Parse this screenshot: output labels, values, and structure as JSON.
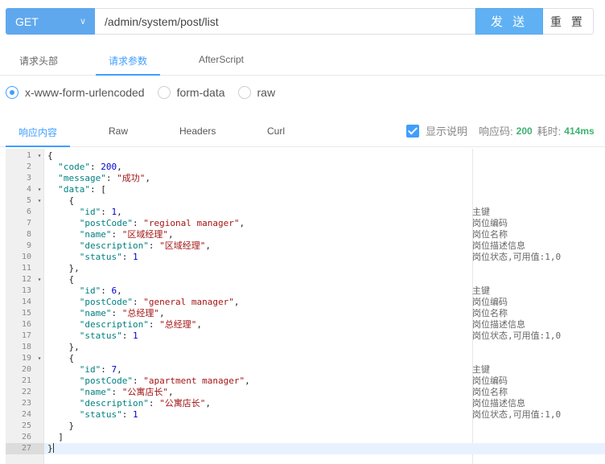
{
  "request": {
    "method": "GET",
    "url": "/admin/system/post/list",
    "send_label": "发 送",
    "reset_label": "重 置"
  },
  "request_tabs": [
    {
      "label": "请求头部",
      "active": false
    },
    {
      "label": "请求参数",
      "active": true
    },
    {
      "label": "AfterScript",
      "active": false
    }
  ],
  "body_types": [
    {
      "label": "x-www-form-urlencoded",
      "checked": true
    },
    {
      "label": "form-data",
      "checked": false
    },
    {
      "label": "raw",
      "checked": false
    }
  ],
  "response_tabs": [
    {
      "label": "响应内容",
      "active": true
    },
    {
      "label": "Raw",
      "active": false
    },
    {
      "label": "Headers",
      "active": false
    },
    {
      "label": "Curl",
      "active": false
    }
  ],
  "response_info": {
    "show_desc_label": "显示说明",
    "show_desc_checked": true,
    "status_label": "响应码:",
    "status_code": "200",
    "time_label": "耗时:",
    "time_value": "414ms"
  },
  "colors": {
    "accent": "#409eff",
    "method_bg": "#5fa8ee",
    "send_bg": "#5fb1f3",
    "success": "#3cb371"
  },
  "editor": {
    "current_line": 27,
    "lines": [
      {
        "n": "1",
        "fold": true,
        "code": "{",
        "comment": ""
      },
      {
        "n": "2",
        "fold": false,
        "code": "  \"code\": 200,",
        "comment": ""
      },
      {
        "n": "3",
        "fold": false,
        "code": "  \"message\": \"成功\",",
        "comment": ""
      },
      {
        "n": "4",
        "fold": true,
        "code": "  \"data\": [",
        "comment": ""
      },
      {
        "n": "5",
        "fold": true,
        "code": "    {",
        "comment": ""
      },
      {
        "n": "6",
        "fold": false,
        "code": "      \"id\": 1,",
        "comment": "主键"
      },
      {
        "n": "7",
        "fold": false,
        "code": "      \"postCode\": \"regional manager\",",
        "comment": "岗位编码"
      },
      {
        "n": "8",
        "fold": false,
        "code": "      \"name\": \"区域经理\",",
        "comment": "岗位名称"
      },
      {
        "n": "9",
        "fold": false,
        "code": "      \"description\": \"区域经理\",",
        "comment": "岗位描述信息"
      },
      {
        "n": "10",
        "fold": false,
        "code": "      \"status\": 1",
        "comment": "岗位状态,可用值:1,0"
      },
      {
        "n": "11",
        "fold": false,
        "code": "    },",
        "comment": ""
      },
      {
        "n": "12",
        "fold": true,
        "code": "    {",
        "comment": ""
      },
      {
        "n": "13",
        "fold": false,
        "code": "      \"id\": 6,",
        "comment": "主键"
      },
      {
        "n": "14",
        "fold": false,
        "code": "      \"postCode\": \"general manager\",",
        "comment": "岗位编码"
      },
      {
        "n": "15",
        "fold": false,
        "code": "      \"name\": \"总经理\",",
        "comment": "岗位名称"
      },
      {
        "n": "16",
        "fold": false,
        "code": "      \"description\": \"总经理\",",
        "comment": "岗位描述信息"
      },
      {
        "n": "17",
        "fold": false,
        "code": "      \"status\": 1",
        "comment": "岗位状态,可用值:1,0"
      },
      {
        "n": "18",
        "fold": false,
        "code": "    },",
        "comment": ""
      },
      {
        "n": "19",
        "fold": true,
        "code": "    {",
        "comment": ""
      },
      {
        "n": "20",
        "fold": false,
        "code": "      \"id\": 7,",
        "comment": "主键"
      },
      {
        "n": "21",
        "fold": false,
        "code": "      \"postCode\": \"apartment manager\",",
        "comment": "岗位编码"
      },
      {
        "n": "22",
        "fold": false,
        "code": "      \"name\": \"公寓店长\",",
        "comment": "岗位名称"
      },
      {
        "n": "23",
        "fold": false,
        "code": "      \"description\": \"公寓店长\",",
        "comment": "岗位描述信息"
      },
      {
        "n": "24",
        "fold": false,
        "code": "      \"status\": 1",
        "comment": "岗位状态,可用值:1,0"
      },
      {
        "n": "25",
        "fold": false,
        "code": "    }",
        "comment": ""
      },
      {
        "n": "26",
        "fold": false,
        "code": "  ]",
        "comment": ""
      },
      {
        "n": "27",
        "fold": false,
        "code": "}",
        "comment": ""
      }
    ]
  }
}
